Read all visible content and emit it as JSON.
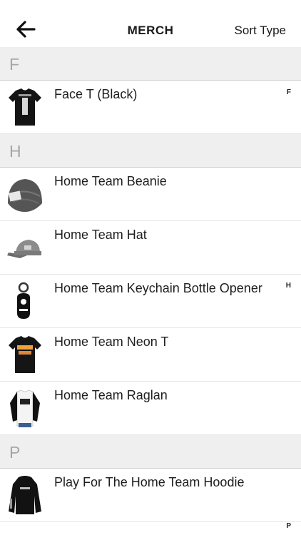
{
  "header": {
    "title": "MERCH",
    "sort_label": "Sort Type"
  },
  "sections": [
    {
      "letter": "F",
      "items": [
        "Face T (Black)"
      ]
    },
    {
      "letter": "H",
      "items": [
        "Home Team Beanie",
        "Home Team Hat",
        "Home Team Keychain Bottle Opener",
        "Home Team Neon T",
        "Home Team Raglan"
      ]
    },
    {
      "letter": "P",
      "items": [
        "Play For The Home Team Hoodie"
      ]
    }
  ],
  "index_letters": [
    "F",
    "H",
    "P"
  ]
}
